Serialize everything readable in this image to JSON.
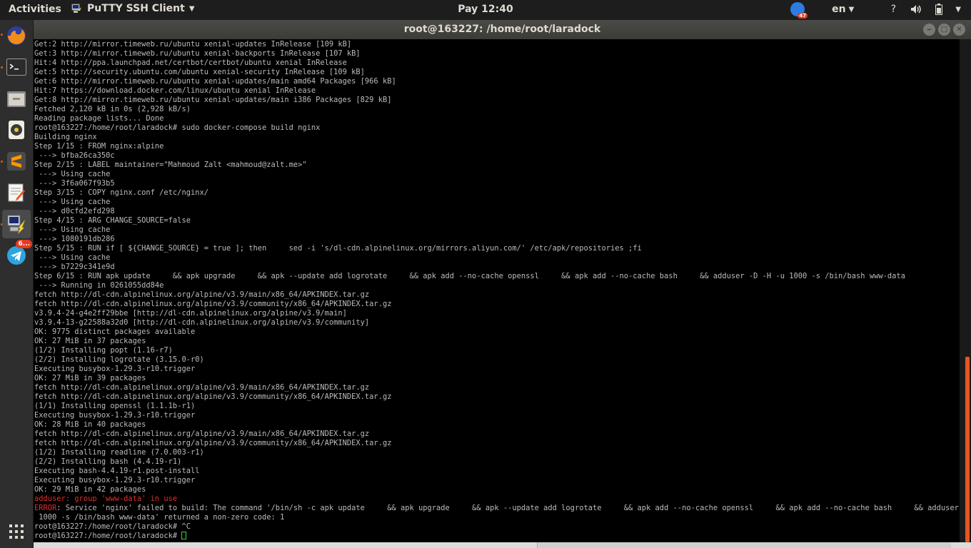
{
  "topbar": {
    "activities": "Activities",
    "app_name": "PuTTY SSH Client",
    "clock": "Pay 12:40",
    "notification_badge": "47",
    "language": "en"
  },
  "dock": {
    "telegram_badge": "6..."
  },
  "window": {
    "title": "root@163227: /home/root/laradock"
  },
  "terminal": {
    "lines": [
      "Get:2 http://mirror.timeweb.ru/ubuntu xenial-updates InRelease [109 kB]",
      "Get:3 http://mirror.timeweb.ru/ubuntu xenial-backports InRelease [107 kB]",
      "Hit:4 http://ppa.launchpad.net/certbot/certbot/ubuntu xenial InRelease",
      "Get:5 http://security.ubuntu.com/ubuntu xenial-security InRelease [109 kB]",
      "Get:6 http://mirror.timeweb.ru/ubuntu xenial-updates/main amd64 Packages [966 kB]",
      "Hit:7 https://download.docker.com/linux/ubuntu xenial InRelease",
      "Get:8 http://mirror.timeweb.ru/ubuntu xenial-updates/main i386 Packages [829 kB]",
      "Fetched 2,120 kB in 0s (2,928 kB/s)",
      "Reading package lists... Done",
      "root@163227:/home/root/laradock# sudo docker-compose build nginx",
      "Building nginx",
      "Step 1/15 : FROM nginx:alpine",
      " ---> bfba26ca350c",
      "Step 2/15 : LABEL maintainer=\"Mahmoud Zalt <mahmoud@zalt.me>\"",
      " ---> Using cache",
      " ---> 3f6a067f93b5",
      "Step 3/15 : COPY nginx.conf /etc/nginx/",
      " ---> Using cache",
      " ---> d0cfd2efd298",
      "Step 4/15 : ARG CHANGE_SOURCE=false",
      " ---> Using cache",
      " ---> 1080191db286",
      "Step 5/15 : RUN if [ ${CHANGE_SOURCE} = true ]; then     sed -i 's/dl-cdn.alpinelinux.org/mirrors.aliyun.com/' /etc/apk/repositories ;fi",
      " ---> Using cache",
      " ---> b7229c341e9d",
      "Step 6/15 : RUN apk update     && apk upgrade     && apk --update add logrotate     && apk add --no-cache openssl     && apk add --no-cache bash     && adduser -D -H -u 1000 -s /bin/bash www-data",
      " ---> Running in 0261055dd84e",
      "fetch http://dl-cdn.alpinelinux.org/alpine/v3.9/main/x86_64/APKINDEX.tar.gz",
      "fetch http://dl-cdn.alpinelinux.org/alpine/v3.9/community/x86_64/APKINDEX.tar.gz",
      "v3.9.4-24-g4e2ff29bbe [http://dl-cdn.alpinelinux.org/alpine/v3.9/main]",
      "v3.9.4-13-g22588a32d0 [http://dl-cdn.alpinelinux.org/alpine/v3.9/community]",
      "OK: 9775 distinct packages available",
      "OK: 27 MiB in 37 packages",
      "(1/2) Installing popt (1.16-r7)",
      "(2/2) Installing logrotate (3.15.0-r0)",
      "Executing busybox-1.29.3-r10.trigger",
      "OK: 27 MiB in 39 packages",
      "fetch http://dl-cdn.alpinelinux.org/alpine/v3.9/main/x86_64/APKINDEX.tar.gz",
      "fetch http://dl-cdn.alpinelinux.org/alpine/v3.9/community/x86_64/APKINDEX.tar.gz",
      "(1/1) Installing openssl (1.1.1b-r1)",
      "Executing busybox-1.29.3-r10.trigger",
      "OK: 28 MiB in 40 packages",
      "fetch http://dl-cdn.alpinelinux.org/alpine/v3.9/main/x86_64/APKINDEX.tar.gz",
      "fetch http://dl-cdn.alpinelinux.org/alpine/v3.9/community/x86_64/APKINDEX.tar.gz",
      "(1/2) Installing readline (7.0.003-r1)",
      "(2/2) Installing bash (4.4.19-r1)",
      "Executing bash-4.4.19-r1.post-install",
      "Executing busybox-1.29.3-r10.trigger",
      "OK: 29 MiB in 42 packages"
    ],
    "adduser_error": "adduser: group 'www-data' in use",
    "error_label": "ERROR",
    "error_message": ": Service 'nginx' failed to build: The command '/bin/sh -c apk update     && apk upgrade     && apk --update add logrotate     && apk add --no-cache openssl     && apk add --no-cache bash     && adduser -D -H -u",
    "error_continuation": " 1000 -s /bin/bash www-data' returned a non-zero code: 1",
    "ctrl_c_line": "root@163227:/home/root/laradock# ^C",
    "prompt": "root@163227:/home/root/laradock# "
  },
  "colors": {
    "error_red": "#e0302a",
    "cursor_green": "#3cd23c",
    "ubuntu_orange": "#e95420"
  },
  "icons": [
    "putty-icon",
    "firefox-icon",
    "terminal-icon",
    "files-icon",
    "rhythmbox-icon",
    "sublime-text-icon",
    "text-editor-icon",
    "putty-dock-icon",
    "telegram-icon",
    "show-apps-icon",
    "network-icon",
    "volume-icon",
    "battery-icon",
    "help-icon"
  ]
}
